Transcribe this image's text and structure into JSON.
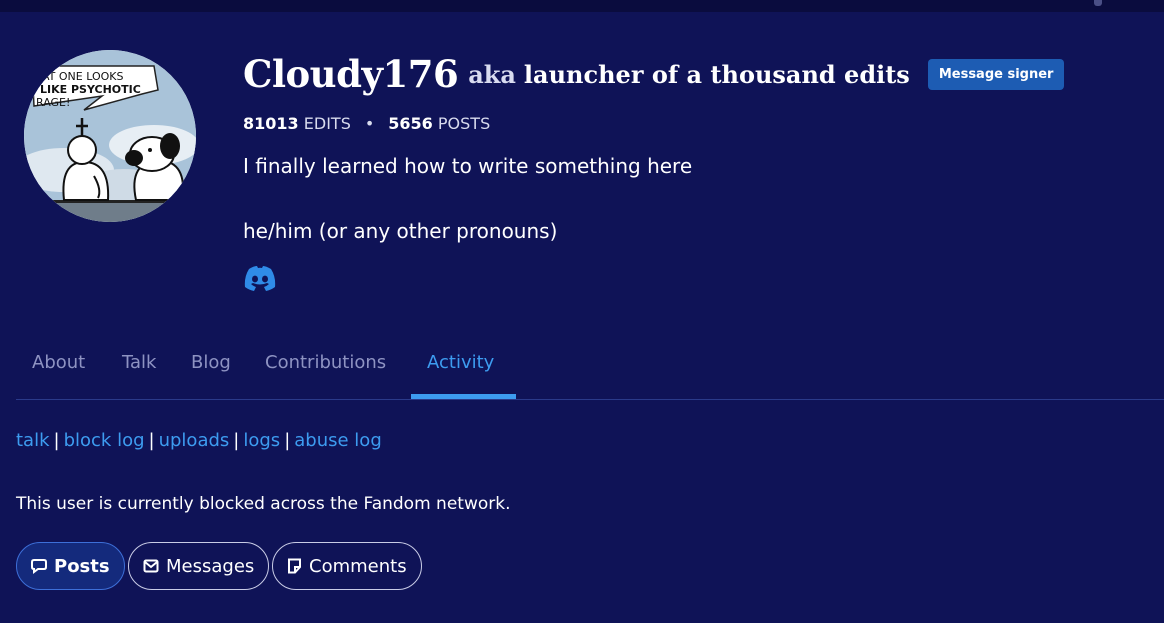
{
  "avatar": {
    "icon": "comic-avatar",
    "speech_lines": [
      "AT ONE LOOKS",
      "LIKE PSYCHOTIC",
      "RAGE!"
    ]
  },
  "profile": {
    "username": "Cloudy176",
    "aka": "aka",
    "title": "launcher of a thousand edits",
    "badge": "Message signer",
    "edits_count": "81013",
    "edits_label": "EDITS",
    "separator": "•",
    "posts_count": "5656",
    "posts_label": "POSTS",
    "bio_line1": "I finally learned how to write something here",
    "bio_line2": "he/him (or any other pronouns)",
    "social_icon": "discord-icon"
  },
  "tabs": [
    {
      "label": "About",
      "active": false
    },
    {
      "label": "Talk",
      "active": false
    },
    {
      "label": "Blog",
      "active": false
    },
    {
      "label": "Contributions",
      "active": false
    },
    {
      "label": "Activity",
      "active": true
    }
  ],
  "links": [
    "talk",
    "block log",
    "uploads",
    "logs",
    "abuse log"
  ],
  "link_separator": "|",
  "status_text": "This user is currently blocked across the Fandom network.",
  "activity_buttons": [
    {
      "label": "Posts",
      "icon": "speech-bubble-icon",
      "active": true
    },
    {
      "label": "Messages",
      "icon": "envelope-icon",
      "active": false
    },
    {
      "label": "Comments",
      "icon": "comment-note-icon",
      "active": false
    }
  ],
  "colors": {
    "background": "#0f1357",
    "accent": "#3d9cf0",
    "badge": "#1d5cb3",
    "inactive_tab": "#8e93c2"
  }
}
